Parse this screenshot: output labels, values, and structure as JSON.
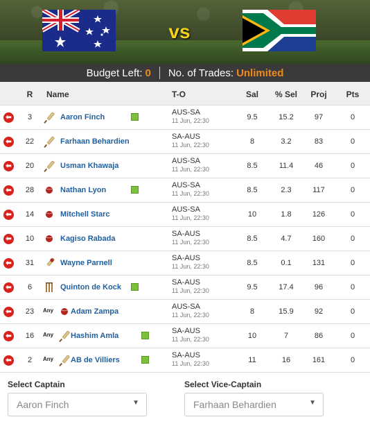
{
  "match": {
    "home_team": "AUS",
    "away_team": "SA",
    "vs_label": "vs",
    "home_flag_icon": "australia-flag-icon",
    "away_flag_icon": "south-africa-flag-icon"
  },
  "budget": {
    "budget_label": "Budget Left:",
    "budget_value": "0",
    "trades_label": "No. of Trades:",
    "trades_value": "Unlimited",
    "accent_color": "#f08a1c"
  },
  "table": {
    "headers": {
      "r": "R",
      "name": "Name",
      "to": "T-O",
      "sal": "Sal",
      "sel": "% Sel",
      "proj": "Proj",
      "pts": "Pts"
    },
    "rows": [
      {
        "r": "3",
        "any": "",
        "icon": "bat-icon",
        "name": "Aaron Finch",
        "pitch": true,
        "team": "AUS-SA",
        "when": "11 Jun, 22:30",
        "sal": "9.5",
        "sel": "15.2",
        "proj": "97",
        "pts": "0"
      },
      {
        "r": "22",
        "any": "",
        "icon": "bat-icon",
        "name": "Farhaan Behardien",
        "pitch": false,
        "team": "SA-AUS",
        "when": "11 Jun, 22:30",
        "sal": "8",
        "sel": "3.2",
        "proj": "83",
        "pts": "0"
      },
      {
        "r": "20",
        "any": "",
        "icon": "bat-icon",
        "name": "Usman Khawaja",
        "pitch": false,
        "team": "AUS-SA",
        "when": "11 Jun, 22:30",
        "sal": "8.5",
        "sel": "11.4",
        "proj": "46",
        "pts": "0"
      },
      {
        "r": "28",
        "any": "",
        "icon": "ball-icon",
        "name": "Nathan Lyon",
        "pitch": true,
        "team": "AUS-SA",
        "when": "11 Jun, 22:30",
        "sal": "8.5",
        "sel": "2.3",
        "proj": "117",
        "pts": "0"
      },
      {
        "r": "14",
        "any": "",
        "icon": "ball-icon",
        "name": "Mitchell Starc",
        "pitch": false,
        "team": "AUS-SA",
        "when": "11 Jun, 22:30",
        "sal": "10",
        "sel": "1.8",
        "proj": "126",
        "pts": "0"
      },
      {
        "r": "10",
        "any": "",
        "icon": "ball-icon",
        "name": "Kagiso Rabada",
        "pitch": false,
        "team": "SA-AUS",
        "when": "11 Jun, 22:30",
        "sal": "8.5",
        "sel": "4.7",
        "proj": "160",
        "pts": "0"
      },
      {
        "r": "31",
        "any": "",
        "icon": "bat-and-ball-icon",
        "name": "Wayne Parnell",
        "pitch": false,
        "team": "SA-AUS",
        "when": "11 Jun, 22:30",
        "sal": "8.5",
        "sel": "0.1",
        "proj": "131",
        "pts": "0"
      },
      {
        "r": "6",
        "any": "",
        "icon": "wicket-icon",
        "name": "Quinton de Kock",
        "pitch": true,
        "team": "SA-AUS",
        "when": "11 Jun, 22:30",
        "sal": "9.5",
        "sel": "17.4",
        "proj": "96",
        "pts": "0"
      },
      {
        "r": "23",
        "any": "Any",
        "icon": "ball-icon",
        "name": "Adam Zampa",
        "pitch": false,
        "team": "AUS-SA",
        "when": "11 Jun, 22:30",
        "sal": "8",
        "sel": "15.9",
        "proj": "92",
        "pts": "0"
      },
      {
        "r": "16",
        "any": "Any",
        "icon": "bat-icon",
        "name": "Hashim Amla",
        "pitch": true,
        "team": "SA-AUS",
        "when": "11 Jun, 22:30",
        "sal": "10",
        "sel": "7",
        "proj": "86",
        "pts": "0"
      },
      {
        "r": "2",
        "any": "Any",
        "icon": "bat-icon",
        "name": "AB de Villiers",
        "pitch": true,
        "team": "SA-AUS",
        "when": "11 Jun, 22:30",
        "sal": "11",
        "sel": "16",
        "proj": "161",
        "pts": "0"
      }
    ]
  },
  "captain": {
    "captain_label": "Select Captain",
    "captain_value": "Aaron Finch",
    "vice_label": "Select Vice-Captain",
    "vice_value": "Farhaan Behardien"
  }
}
